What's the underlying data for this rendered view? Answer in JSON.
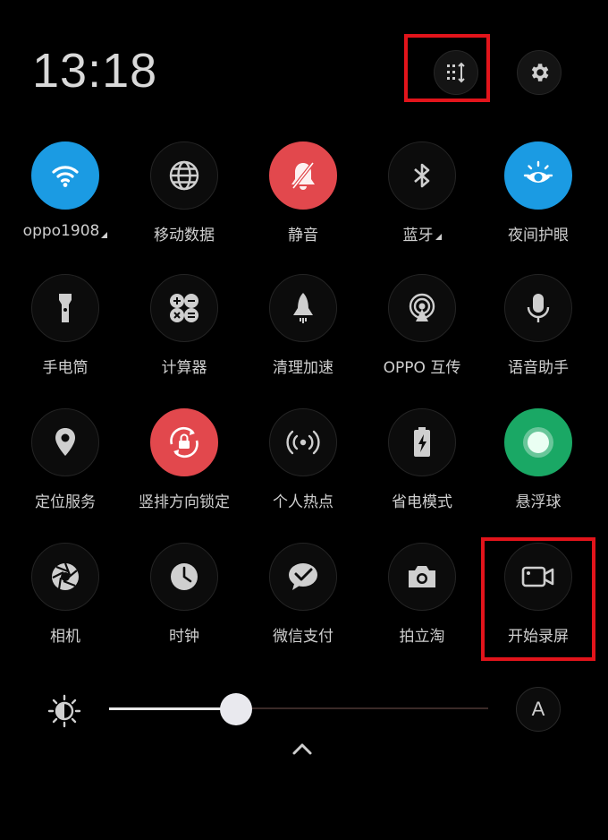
{
  "status": {
    "time": "13:18"
  },
  "brightness": {
    "auto_label": "A",
    "level_percent": 33
  },
  "colors": {
    "wifi_active": "#1b9be3",
    "mute_active": "#e2484d",
    "rotation_lock_active": "#e2484d",
    "floating_ball_active": "#1aa865",
    "highlight_box": "#e2141b"
  },
  "tiles": [
    {
      "label": "oppo1908",
      "icon": "wifi-icon",
      "active": true
    },
    {
      "label": "移动数据",
      "icon": "globe-icon",
      "active": false
    },
    {
      "label": "静音",
      "icon": "bell-off-icon",
      "active": true
    },
    {
      "label": "蓝牙",
      "icon": "bluetooth-icon",
      "active": false
    },
    {
      "label": "夜间护眼",
      "icon": "eye-sun-icon",
      "active": true
    },
    {
      "label": "手电筒",
      "icon": "flashlight-icon",
      "active": false
    },
    {
      "label": "计算器",
      "icon": "calculator-icon",
      "active": false
    },
    {
      "label": "清理加速",
      "icon": "rocket-icon",
      "active": false
    },
    {
      "label": "OPPO 互传",
      "icon": "share-icon",
      "active": false
    },
    {
      "label": "语音助手",
      "icon": "microphone-icon",
      "active": false
    },
    {
      "label": "定位服务",
      "icon": "location-pin-icon",
      "active": false
    },
    {
      "label": "竖排方向锁定",
      "icon": "rotation-lock-icon",
      "active": true
    },
    {
      "label": "个人热点",
      "icon": "hotspot-icon",
      "active": false
    },
    {
      "label": "省电模式",
      "icon": "battery-icon",
      "active": false
    },
    {
      "label": "悬浮球",
      "icon": "floating-ball-icon",
      "active": true
    },
    {
      "label": "相机",
      "icon": "camera-aperture-icon",
      "active": false
    },
    {
      "label": "时钟",
      "icon": "clock-icon",
      "active": false
    },
    {
      "label": "微信支付",
      "icon": "wechat-pay-icon",
      "active": false
    },
    {
      "label": "拍立淘",
      "icon": "camera-icon",
      "active": false
    },
    {
      "label": "开始录屏",
      "icon": "video-camera-icon",
      "active": false
    }
  ]
}
